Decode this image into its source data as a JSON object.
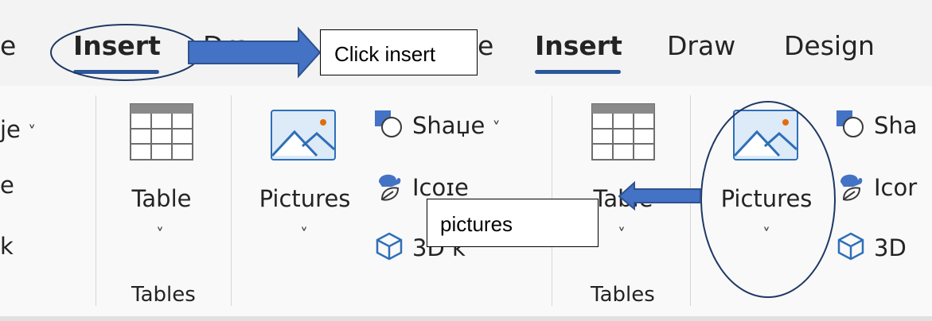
{
  "tabs": {
    "home_fragment": "e",
    "left_insert": "Insert",
    "left_draw_fragment": "Draw",
    "right_home_fragment": "e",
    "right_insert": "Insert",
    "draw": "Draw",
    "design": "Design"
  },
  "left_ribbon": {
    "cut_items": [
      "je",
      "e",
      "k"
    ],
    "table_label": "Table",
    "tables_group": "Tables",
    "pictures_label": "Pictures",
    "shapes_label": "Shaџe",
    "icons_label": "Icoɪe",
    "models_label": "3D k"
  },
  "right_ribbon": {
    "table_label": "Table",
    "tables_group": "Tables",
    "pictures_label": "Pictures",
    "shapes_label": "Sha",
    "icons_label": "Icor",
    "models_label": "3D"
  },
  "annotations": {
    "click_insert": "Click insert",
    "pictures": "pictures"
  },
  "colors": {
    "accent": "#2b579a",
    "annotation_arrow": "#4472c4",
    "annotation_circle": "#1f3864",
    "picture_icon_fill": "#ddeaf7",
    "picture_icon_stroke": "#2e6fb7",
    "picture_icon_sun": "#e36c09"
  }
}
